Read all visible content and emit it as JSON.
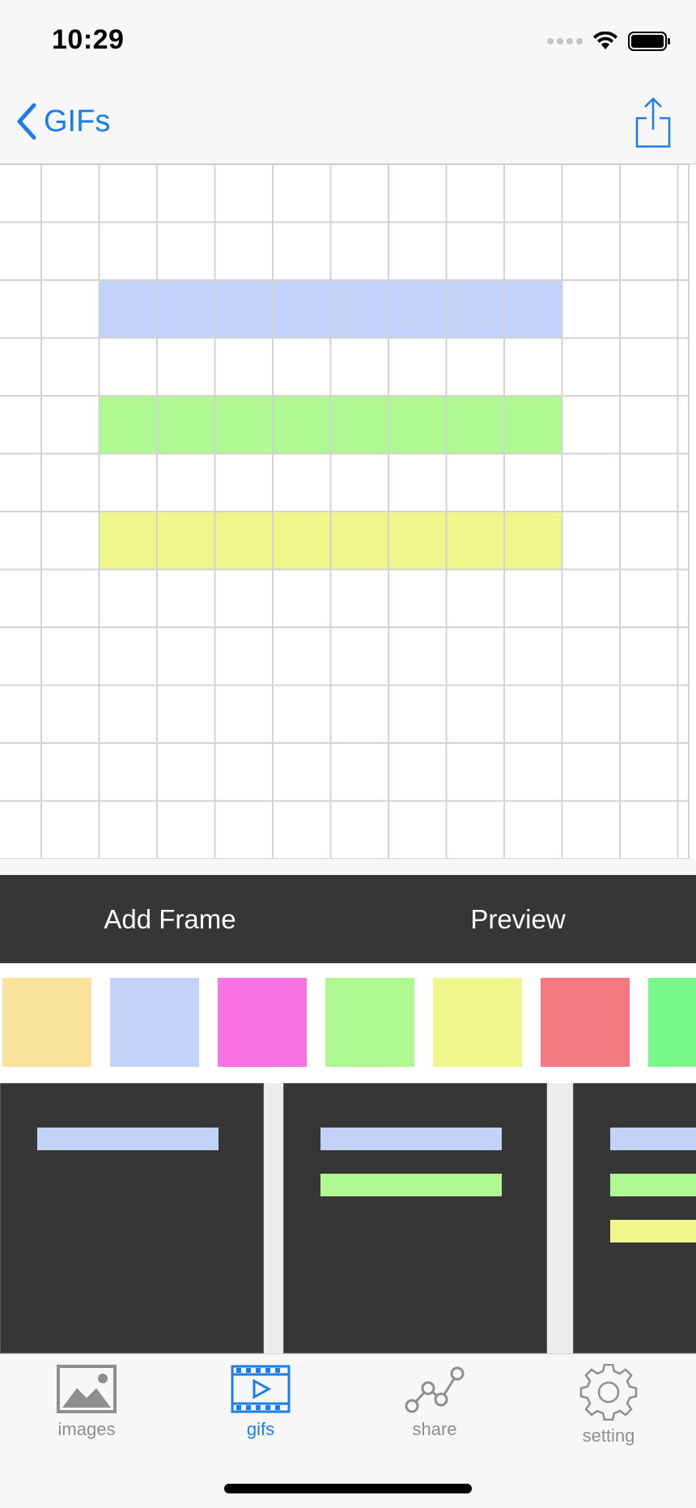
{
  "status_bar": {
    "time": "10:29"
  },
  "nav": {
    "back_label": "GIFs"
  },
  "grid": {
    "columns": 12,
    "rows": 12,
    "filled_rows": [
      {
        "row": 2,
        "col_start": 2,
        "col_end": 9,
        "color": "#c3d2f8"
      },
      {
        "row": 4,
        "col_start": 2,
        "col_end": 9,
        "color": "#b0f891"
      },
      {
        "row": 6,
        "col_start": 2,
        "col_end": 9,
        "color": "#eff78a"
      }
    ]
  },
  "toolbar": {
    "add_frame_label": "Add Frame",
    "preview_label": "Preview"
  },
  "palette": [
    "#f9e39a",
    "#c3d2f8",
    "#f973e2",
    "#b0f891",
    "#eff78a",
    "#f47880",
    "#78f889"
  ],
  "frames": [
    {
      "bars": [
        "#c3d2f8"
      ]
    },
    {
      "bars": [
        "#c3d2f8",
        "#b0f891"
      ]
    },
    {
      "bars": [
        "#c3d2f8",
        "#b0f891",
        "#eff78a"
      ]
    }
  ],
  "tabs": [
    {
      "label": "images",
      "icon": "image-icon",
      "active": false
    },
    {
      "label": "gifs",
      "icon": "film-icon",
      "active": true
    },
    {
      "label": "share",
      "icon": "share-graph-icon",
      "active": false
    },
    {
      "label": "setting",
      "icon": "gear-icon",
      "active": false
    }
  ],
  "colors": {
    "accent": "#1a7cf5",
    "toolbar_bg": "#363636",
    "grid_line": "#d3d3d3"
  }
}
